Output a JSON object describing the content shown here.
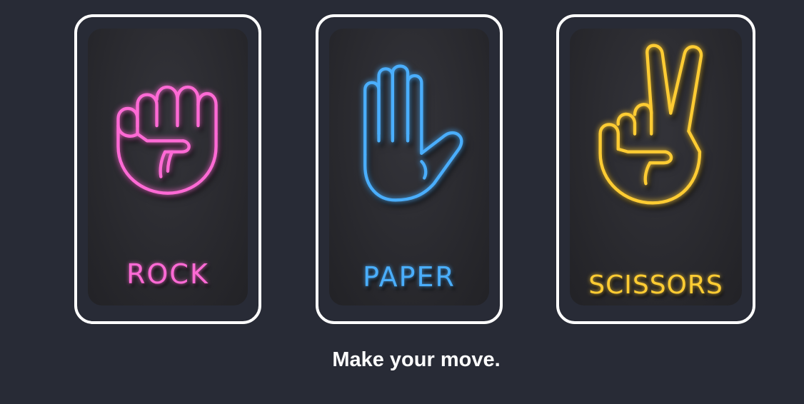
{
  "choices": [
    {
      "label": "ROCK",
      "icon": "fist-icon",
      "color": "#ff6ad5"
    },
    {
      "label": "PAPER",
      "icon": "open-hand-icon",
      "color": "#4aaefc"
    },
    {
      "label": "SCISSORS",
      "icon": "peace-sign-hand-icon",
      "color": "#ffcc33"
    }
  ],
  "prompt": "Make your move.",
  "colors": {
    "background": "#282b36",
    "card_border": "#ffffff"
  }
}
